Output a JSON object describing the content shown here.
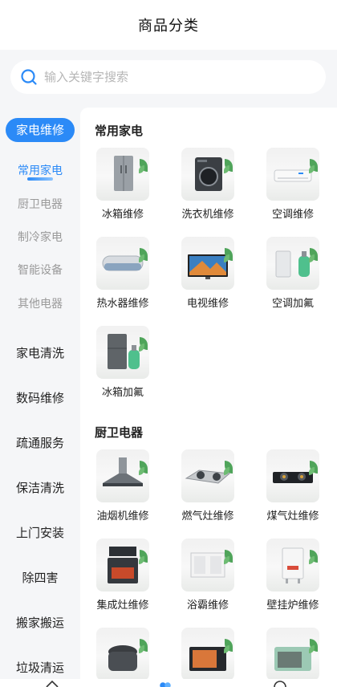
{
  "header": {
    "title": "商品分类"
  },
  "search": {
    "placeholder": "输入关键字搜索"
  },
  "sidebar": {
    "active_main": "家电维修",
    "sub_categories": [
      {
        "label": "常用家电",
        "active": true
      },
      {
        "label": "厨卫电器",
        "active": false
      },
      {
        "label": "制冷家电",
        "active": false
      },
      {
        "label": "智能设备",
        "active": false
      },
      {
        "label": "其他电器",
        "active": false
      }
    ],
    "main_categories": [
      "家电清洗",
      "数码维修",
      "疏通服务",
      "保洁清洗",
      "上门安装",
      "除四害",
      "搬家搬运",
      "垃圾清运"
    ]
  },
  "sections": [
    {
      "title": "常用家电",
      "items": [
        {
          "label": "冰箱维修",
          "icon": "fridge-icon"
        },
        {
          "label": "洗衣机维修",
          "icon": "washer-icon"
        },
        {
          "label": "空调维修",
          "icon": "air-conditioner-icon"
        },
        {
          "label": "热水器维修",
          "icon": "water-heater-icon"
        },
        {
          "label": "电视维修",
          "icon": "tv-icon"
        },
        {
          "label": "空调加氟",
          "icon": "refrigerant-tank-icon"
        },
        {
          "label": "冰箱加氟",
          "icon": "fridge-refrigerant-icon"
        }
      ]
    },
    {
      "title": "厨卫电器",
      "items": [
        {
          "label": "油烟机维修",
          "icon": "range-hood-icon"
        },
        {
          "label": "燃气灶维修",
          "icon": "gas-stove-icon"
        },
        {
          "label": "煤气灶维修",
          "icon": "coal-gas-stove-icon"
        },
        {
          "label": "集成灶维修",
          "icon": "integrated-stove-icon"
        },
        {
          "label": "浴霸维修",
          "icon": "bath-heater-icon"
        },
        {
          "label": "壁挂炉维修",
          "icon": "wall-boiler-icon"
        },
        {
          "label": "",
          "icon": "rice-cooker-icon"
        },
        {
          "label": "",
          "icon": "microwave-icon"
        },
        {
          "label": "",
          "icon": "oven-icon"
        }
      ]
    }
  ],
  "colors": {
    "accent": "#2b8af7",
    "background": "#f5f6f8"
  }
}
